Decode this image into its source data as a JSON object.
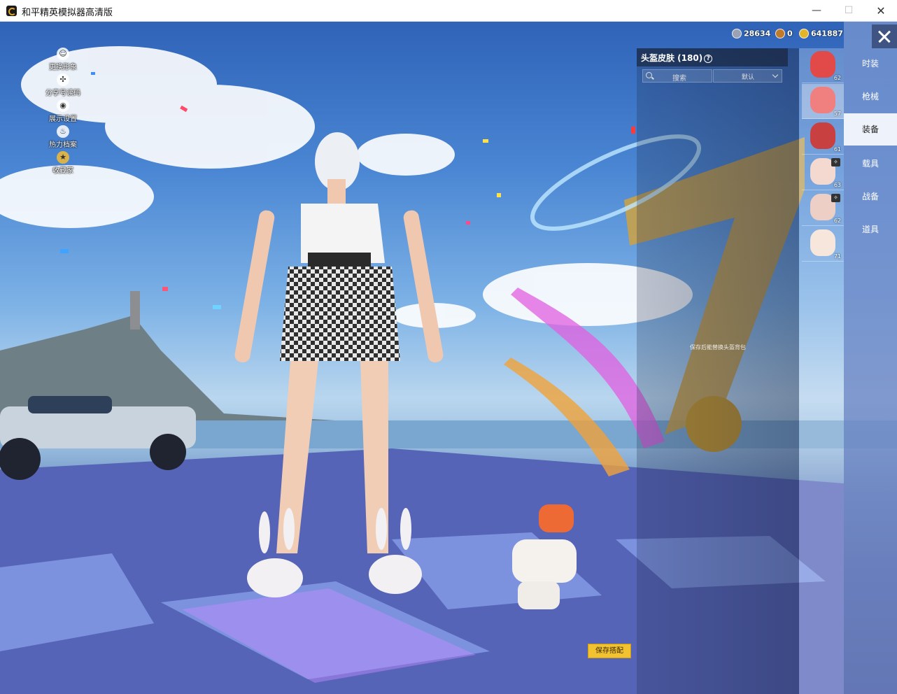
{
  "window": {
    "title": "和平精英模拟器高清版",
    "minimize": "—",
    "maximize": "☐",
    "close": "✕"
  },
  "left_menu": [
    {
      "label": "更换形象",
      "icon": "person-icon"
    },
    {
      "label": "分享号读码",
      "icon": "share-icon"
    },
    {
      "label": "展示设置",
      "icon": "eye-icon"
    },
    {
      "label": "热力档案",
      "icon": "flame-icon"
    },
    {
      "label": "收藏家",
      "icon": "collector-badge-icon"
    }
  ],
  "currency": [
    {
      "icon": "silver-coin-icon",
      "value": "28634",
      "color": "#9aa3b5"
    },
    {
      "icon": "bronze-coin-icon",
      "value": "0",
      "color": "#c07a2b"
    },
    {
      "icon": "gold-coin-icon",
      "value": "641887",
      "color": "#e3b52a"
    }
  ],
  "panel": {
    "title": "头盔皮肤 (180)",
    "help": "?",
    "search_label": "搜索",
    "sort_label": "默认",
    "hint": "保存后能替换头盔背包"
  },
  "skin_items": [
    {
      "count": "62",
      "color": "#e24a4a",
      "badge": ""
    },
    {
      "count": "57",
      "color": "#f08080",
      "badge": ""
    },
    {
      "count": "61",
      "color": "#c94040",
      "badge": ""
    },
    {
      "count": "63",
      "color": "#f4d9d0",
      "badge": "✧"
    },
    {
      "count": "62",
      "color": "#eecfc6",
      "badge": "✧"
    },
    {
      "count": "71",
      "color": "#f6e6dc",
      "badge": ""
    }
  ],
  "categories": [
    {
      "label": "时装",
      "active": false
    },
    {
      "label": "枪械",
      "active": false
    },
    {
      "label": "装备",
      "active": true
    },
    {
      "label": "载具",
      "active": false
    },
    {
      "label": "战备",
      "active": false
    },
    {
      "label": "道具",
      "active": false
    }
  ],
  "save_button": "保存搭配"
}
